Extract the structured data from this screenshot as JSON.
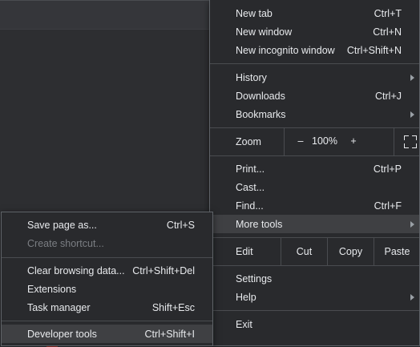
{
  "main_menu": {
    "group1": [
      {
        "label": "New tab",
        "shortcut": "Ctrl+T"
      },
      {
        "label": "New window",
        "shortcut": "Ctrl+N"
      },
      {
        "label": "New incognito window",
        "shortcut": "Ctrl+Shift+N"
      }
    ],
    "group2": [
      {
        "label": "History",
        "shortcut": ""
      },
      {
        "label": "Downloads",
        "shortcut": "Ctrl+J"
      },
      {
        "label": "Bookmarks",
        "shortcut": ""
      }
    ],
    "zoom": {
      "label": "Zoom",
      "minus": "–",
      "value": "100%",
      "plus": "+"
    },
    "group3": [
      {
        "label": "Print...",
        "shortcut": "Ctrl+P"
      },
      {
        "label": "Cast...",
        "shortcut": ""
      },
      {
        "label": "Find...",
        "shortcut": "Ctrl+F"
      },
      {
        "label": "More tools",
        "shortcut": ""
      }
    ],
    "edit": {
      "label": "Edit",
      "cut": "Cut",
      "copy": "Copy",
      "paste": "Paste"
    },
    "group4": [
      {
        "label": "Settings",
        "shortcut": ""
      },
      {
        "label": "Help",
        "shortcut": ""
      }
    ],
    "exit": {
      "label": "Exit"
    }
  },
  "more_tools_menu": {
    "group1": [
      {
        "label": "Save page as...",
        "shortcut": "Ctrl+S"
      },
      {
        "label": "Create shortcut...",
        "shortcut": ""
      }
    ],
    "group2": [
      {
        "label": "Clear browsing data...",
        "shortcut": "Ctrl+Shift+Del"
      },
      {
        "label": "Extensions",
        "shortcut": ""
      },
      {
        "label": "Task manager",
        "shortcut": "Shift+Esc"
      }
    ],
    "group3": [
      {
        "label": "Developer tools",
        "shortcut": "Ctrl+Shift+I"
      }
    ]
  },
  "colors": {
    "menu_bg": "#292a2d",
    "highlight": "#3f4043",
    "text": "#e8eaed",
    "disabled_text": "#7b7e83"
  }
}
